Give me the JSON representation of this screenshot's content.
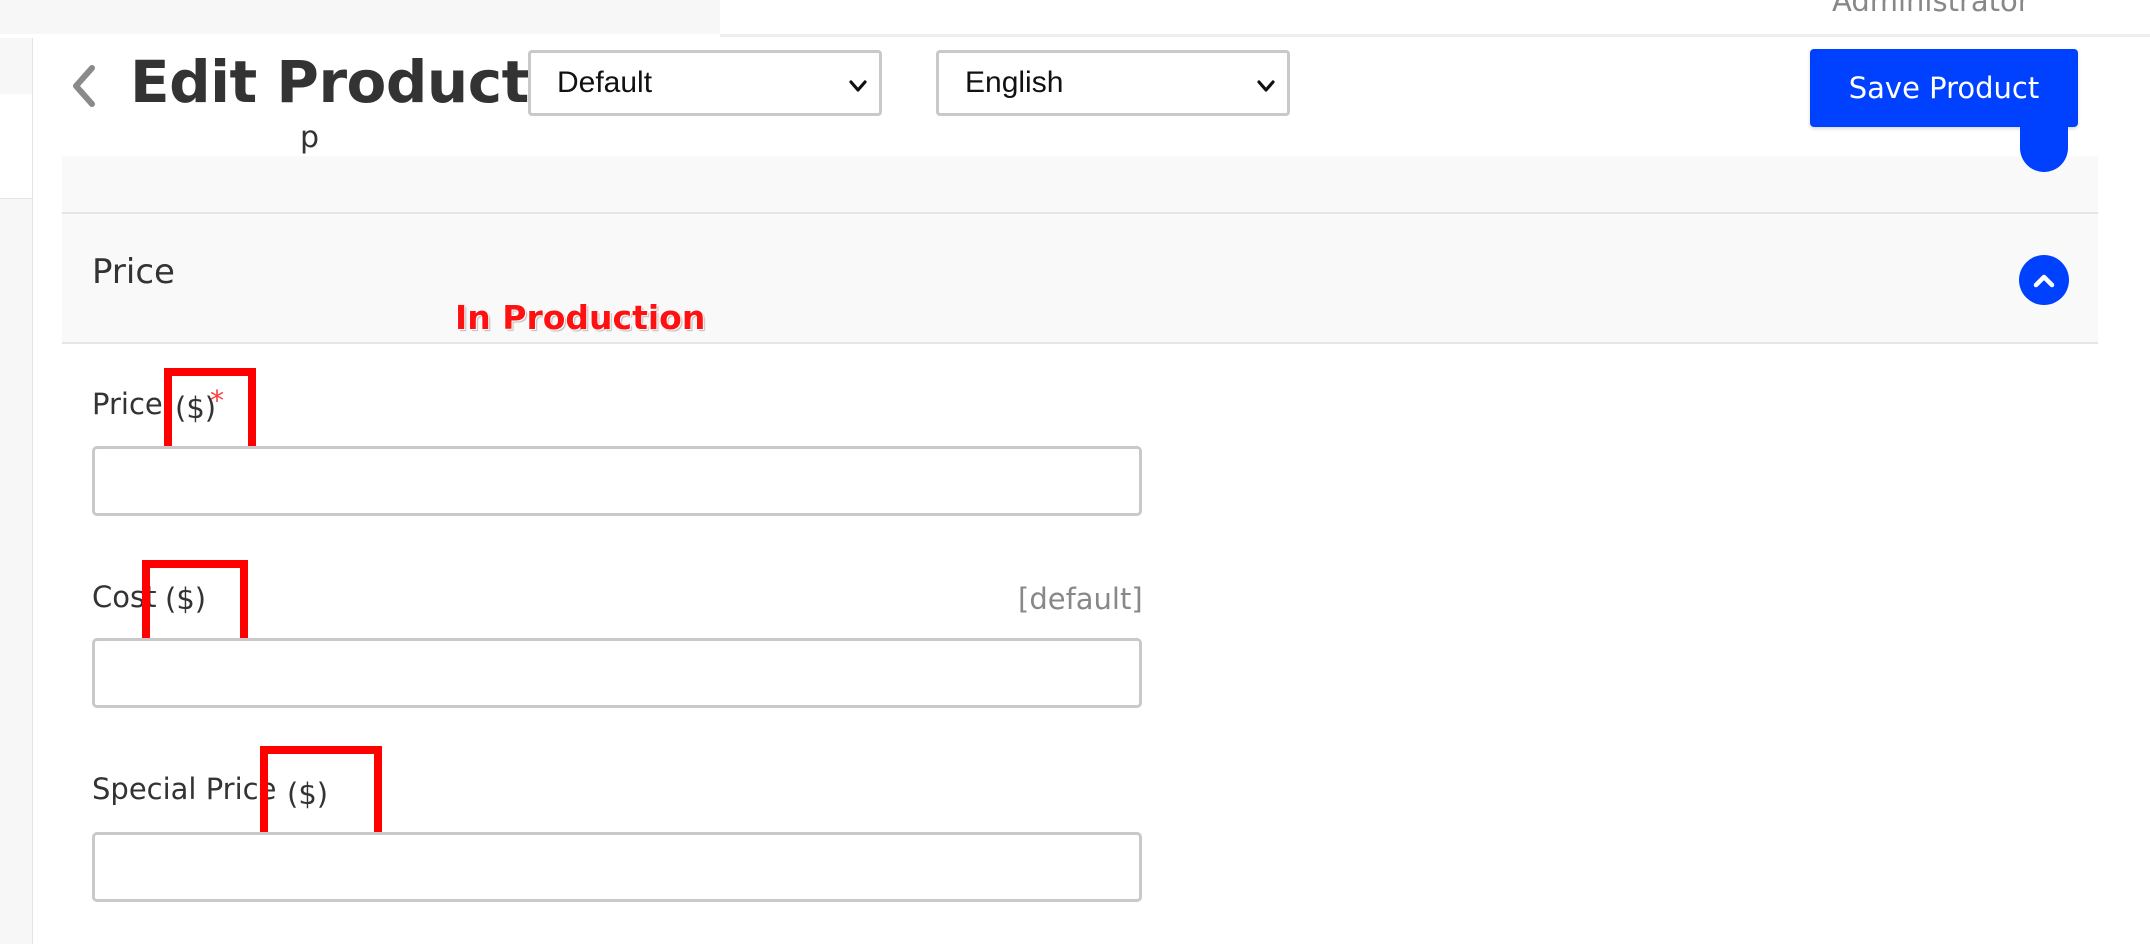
{
  "user": {
    "role": "Administrator"
  },
  "header": {
    "title": "Edit Product",
    "store_select": "Default",
    "language_select": "English",
    "save_label": "Save Product"
  },
  "sections": {
    "previous_section_fragment": "p",
    "price_title": "Price"
  },
  "annotation": {
    "label": "In Production"
  },
  "fields": {
    "price": {
      "label": "Price",
      "unit": "($)",
      "required_mark": "*",
      "value": ""
    },
    "cost": {
      "label": "Cost",
      "unit": "($)",
      "hint": "[default]",
      "value": ""
    },
    "special_price": {
      "label": "Special Price",
      "unit": "($)",
      "value": ""
    }
  },
  "colors": {
    "accent": "#0041ff",
    "highlight": "#ff0000",
    "annotation": "#ff1111",
    "required": "#ff3b3b"
  }
}
